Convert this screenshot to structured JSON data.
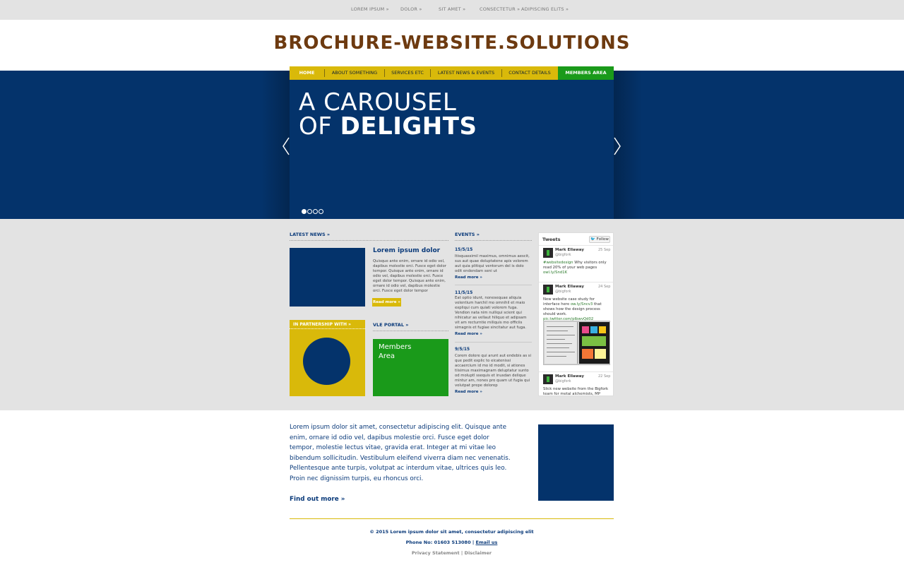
{
  "top_nav": {
    "items": [
      {
        "label": "LOREM IPSUM »"
      },
      {
        "label": "DOLOR »"
      },
      {
        "label": "SIT AMET »"
      },
      {
        "label": "CONSECTETUR »"
      },
      {
        "label": "ADIPISCING ELITS »"
      }
    ]
  },
  "header": {
    "logo": "BROCHURE-WEBSITE.SOLUTIONS"
  },
  "main_nav": {
    "items": [
      {
        "label": "HOME"
      },
      {
        "label": "ABOUT SOMETHING"
      },
      {
        "label": "SERVICES ETC"
      },
      {
        "label": "LATEST NEWS & EVENTS"
      },
      {
        "label": "CONTACT DETAILS"
      }
    ],
    "members": "MEMBERS AREA"
  },
  "hero": {
    "line1": "A CAROUSEL",
    "line2_prefix": "OF ",
    "line2_bold": "DELIGHTS",
    "slide_count": 4,
    "active_slide": 1
  },
  "latest_news": {
    "title": "LATEST NEWS »",
    "headline": "Lorem ipsum dolor",
    "body": "Quisque ante enim, ornare id odio vel, dapibus molestie orci. Fusce eget dolor tempor. Quisque ante enim, ornare id odio vel, dapibus molestie orci. Fusce eget dolor tempor. Quisque ante enim, ornare id odio vel, dapibus molestie orci. Fusce eget dolor tempor",
    "read_more": "Read more »"
  },
  "partnership": {
    "title": "IN PARTNERSHIP WITH »"
  },
  "vle": {
    "title": "VLE PORTAL »",
    "box": "Members Area"
  },
  "events": {
    "title": "EVENTS »",
    "items": [
      {
        "date": "15/5/15",
        "body": "Itisquassimil maximus, omnimus aescit, sus aut quae doluptatene apis volorem aut quia plitiqui ventorum del is dolo odit endendam seni ut",
        "more": "Read more »"
      },
      {
        "date": "11/5/15",
        "body": "Eat optio idunt, nonesequae aliquia volentium harchil mo omnihil et maio expliqui cum quiati volorem fuga. Vendion nata nim nulliqui scient qui nihicatur as vellaut hiliquo et adipsam vit am recturntie miliquis mo officiis simagnis et fugiae sincitatur aut fuga.",
        "more": "Read more »"
      },
      {
        "date": "9/5/15",
        "body": "Corem dolore qui arunt aut endebis as si que pedit explic to eicatenissi accaercium id mo id modit, si ationes tiisimus maximagnam deluptatur sunto od moluptl ssequis et inusdan delique mintur am, nones pro quam ut fugia qui volutpat prepe dolorep",
        "more": "Read more »"
      }
    ]
  },
  "twitter": {
    "title": "Tweets",
    "follow": "Follow",
    "tweets": [
      {
        "name": "Mark Ellaway",
        "handle": "@bigfork",
        "date": "25 Sep",
        "tag": "#websitedesign",
        "text": " Why visitors only read 20% of your web pages ",
        "link": "owl.ly/Snd1K"
      },
      {
        "name": "Mark Ellaway",
        "handle": "@bigfork",
        "date": "24 Sep",
        "tag": "",
        "text": "New website case study for interface here ",
        "link": "ow.ly/Sncv3",
        "text2": " that shows how the design process should work. ",
        "link2": "pic.twitter.com/pIbwvQd02"
      },
      {
        "name": "Mark Ellaway",
        "handle": "@bigfork",
        "date": "22 Sep",
        "tag": "",
        "text": "Slick new website from the Bigfork team for metal alchemists, MP",
        "link": ""
      }
    ]
  },
  "lower": {
    "text": "Lorem ipsum dolor sit amet, consectetur adipiscing elit. Quisque ante enim, ornare id odio vel, dapibus molestie orci. Fusce eget dolor tempor, molestie lectus vitae, gravida erat. Integer at mi vitae leo bibendum sollicitudin. Vestibulum eleifend viverra diam nec venenatis. Pellentesque ante turpis, volutpat ac interdum vitae, ultrices quis leo. Proin nec dignissim turpis, eu rhoncus orci.",
    "find_out": "Find out more »"
  },
  "footer": {
    "copyright": "© 2015 Lorem ipsum dolor sit amet, consectetur adipiscing elit",
    "phone": "Phone No: 01603 513080",
    "email": "Email us",
    "privacy": "Privacy Statement",
    "disclaimer": "Disclaimer"
  },
  "colors": {
    "navy": "#04336b",
    "yellow": "#d9b90a",
    "green": "#1a9a1a",
    "logo_brown": "#6d3a10",
    "grey_bg": "#e3e3e3"
  }
}
